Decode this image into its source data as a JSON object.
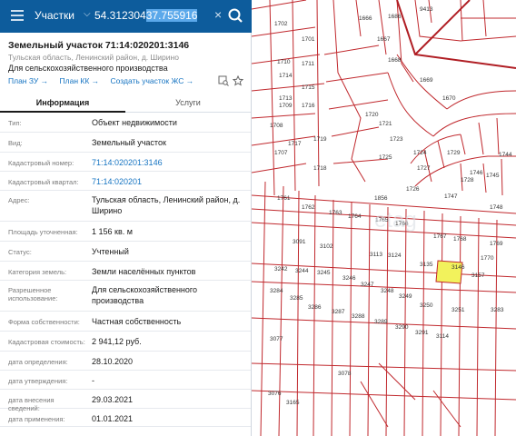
{
  "search": {
    "type_label": "Участки",
    "query_prefix": "54.312304",
    "query_selected": "37.755916"
  },
  "parcel": {
    "title": "Земельный участок 71:14:020201:3146",
    "address_short": "Тульская область, Ленинский район, д. Ширино",
    "purpose": "Для сельскохозяйственного производства"
  },
  "actions": {
    "plan_zu": "План ЗУ →",
    "plan_kk": "План КК →",
    "create_zhs": "Создать участок ЖС →"
  },
  "tabs": {
    "info": "Информация",
    "services": "Услуги"
  },
  "details": [
    {
      "key": "Тип:",
      "value": "Объект недвижимости",
      "link": false
    },
    {
      "key": "Вид:",
      "value": "Земельный участок",
      "link": false
    },
    {
      "key": "Кадастровый номер:",
      "value": "71:14:020201:3146",
      "link": true
    },
    {
      "key": "Кадастровый квартал:",
      "value": "71:14:020201",
      "link": true
    },
    {
      "key": "Адрес:",
      "value": "Тульская область, Ленинский район, д. Ширино",
      "link": false
    },
    {
      "key": "Площадь уточненная:",
      "value": "1 156 кв. м",
      "link": false
    },
    {
      "key": "Статус:",
      "value": "Учтенный",
      "link": false
    },
    {
      "key": "Категория земель:",
      "value": "Земли населённых пунктов",
      "link": false
    },
    {
      "key": "Разрешенное использование:",
      "value": "Для сельскохозяйственного производства",
      "link": false
    },
    {
      "key": "Форма собственности:",
      "value": "Частная собственность",
      "link": false
    },
    {
      "key": "Кадастровая стоимость:",
      "value": "2 941,12 руб.",
      "link": false
    },
    {
      "key": "дата определения:",
      "value": "28.10.2020",
      "link": false
    },
    {
      "key": "дата утверждения:",
      "value": "-",
      "link": false
    },
    {
      "key": "дата внесения сведений:",
      "value": "29.03.2021",
      "link": false
    },
    {
      "key": "дата применения:",
      "value": "01.01.2021",
      "link": false
    }
  ],
  "map": {
    "labels": [
      "1686",
      "9413",
      "1666",
      "1702",
      "1701",
      "1667",
      "1710",
      "1711",
      "1668",
      "1714",
      "1669",
      "1715",
      "1713",
      "1670",
      "1716",
      "1709",
      "1720",
      "1708",
      "1719",
      "1721",
      "1717",
      "1723",
      "1707",
      "1718",
      "1725",
      "1724",
      "1727",
      "1729",
      "1728",
      "1744",
      "1726",
      "1747",
      "1746",
      "1745",
      "1856",
      "1748",
      "1761",
      "1762",
      "1763",
      "1764",
      "1765",
      "1766",
      "1767",
      "1768",
      "1769",
      "1770",
      "3091",
      "3102",
      "3113",
      "3124",
      "3135",
      "3146",
      "3157",
      "3242",
      "3244",
      "3245",
      "3246",
      "3247",
      "3248",
      "3249",
      "3250",
      "3251",
      "3283",
      "3284",
      "3285",
      "3286",
      "3287",
      "3288",
      "3289",
      "3290",
      "3291",
      "3114",
      "3078",
      "3077",
      "3076",
      "3165"
    ],
    "highlight_color": "#f2f25c",
    "line_color": "#c0282d"
  }
}
